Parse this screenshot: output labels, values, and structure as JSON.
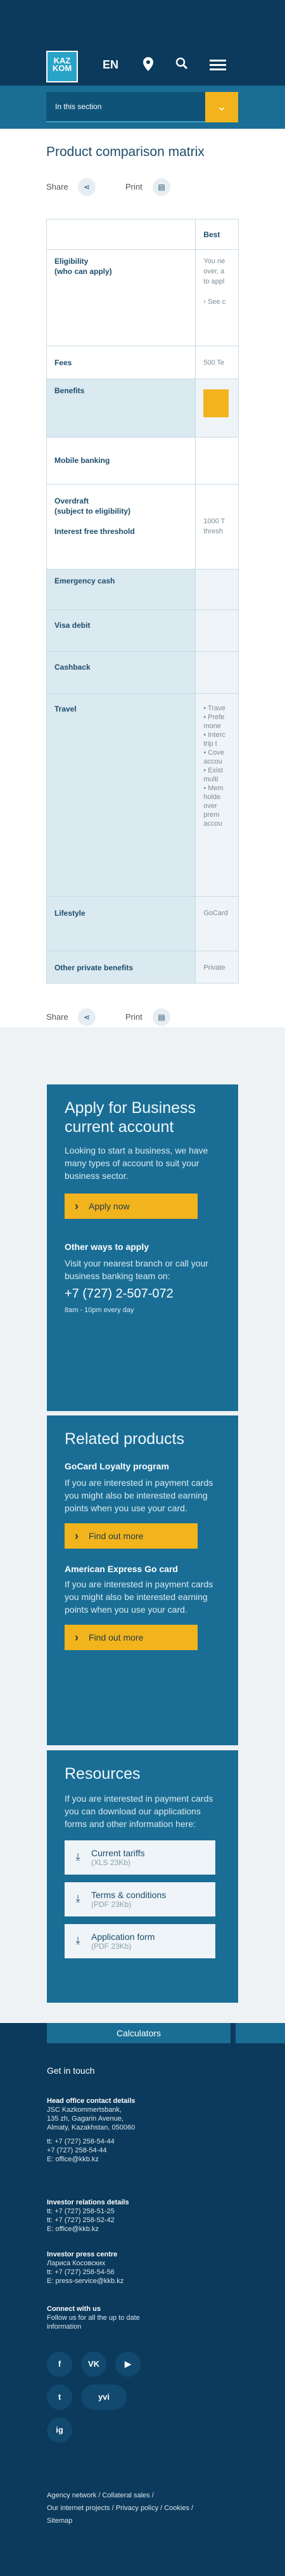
{
  "header": {
    "logo": [
      "KAZ",
      "KOM"
    ],
    "language": "EN",
    "icons": [
      "location-pin-icon",
      "search-icon",
      "menu-icon"
    ]
  },
  "section_nav": {
    "label": "In this section"
  },
  "page": {
    "title": "Product comparison matrix"
  },
  "share": {
    "share_label": "Share",
    "print_label": "Print"
  },
  "matrix": {
    "column_header": "Best",
    "rows": [
      {
        "label": "Eligibility\n(who can apply)",
        "value": "You ne\nover, a\nto appl\n\n› See c"
      },
      {
        "label": "Fees",
        "value": "500 Te"
      },
      {
        "label": "Benefits",
        "value": ""
      },
      {
        "label": "Mobile banking",
        "value": ""
      },
      {
        "label": "Overdraft\n(subject to eligibility)\n\nInterest free threshold",
        "value": "\n\n1000 T\nthresh"
      },
      {
        "label": "Emergency cash",
        "value": ""
      },
      {
        "label": "Visa debit",
        "value": ""
      },
      {
        "label": "Cashback",
        "value": ""
      },
      {
        "label": "Travel",
        "value": "• Trave\n• Prefe\n  mone\n• Interc\n  trip t\n• Cove\n  accou\n• Exist\n  multi\n• Mem\n  holde\n  over\n  prem\n  accou"
      },
      {
        "label": "Lifestyle",
        "value": "GoCard"
      },
      {
        "label": "Other private benefits",
        "value": "Private"
      }
    ]
  },
  "apply": {
    "title": "Apply for Business current account",
    "text": "Looking to start a business, we have many types of account to suit your business sector.",
    "button": "Apply now",
    "other_title": "Other ways to apply",
    "other_text": "Visit your nearest branch or call your business banking team on:",
    "phone": "+7 (727) 2-507-072",
    "hours": "8am - 10pm every day"
  },
  "related": {
    "title": "Related products",
    "items": [
      {
        "title": "GoCard Loyalty program",
        "text": "If you are interested in payment cards you might also be interested earning points when you use your card.",
        "button": "Find out more"
      },
      {
        "title": "American Express Go card",
        "text": "If you are interested in payment cards you might also be interested earning points when you use your card.",
        "button": "Find out more"
      }
    ]
  },
  "resources": {
    "title": "Resources",
    "text": "If you are interested in payment cards you can download our applications forms and other information here:",
    "docs": [
      {
        "name": "Current tariffs",
        "size": "(XLS 23Kb)"
      },
      {
        "name": "Terms & conditions",
        "size": "(PDF 23Kb)"
      },
      {
        "name": "Application form",
        "size": "(PDF 23Kb)"
      }
    ]
  },
  "footer": {
    "calculators": "Calculators",
    "get_in_touch": "Get in touch",
    "head_office_title": "Head office contact details",
    "head_office": [
      "JSC Kazkommertsbank,",
      "135 zh, Gagarin Avenue,",
      "Almaty, Kazakhstan, 050060",
      "",
      "tt: +7 (727) 258-54-44",
      "     +7 (727) 258-54-44",
      "E: office@kkb.kz"
    ],
    "investor_title": "Investor relations details",
    "investor": [
      "tt: +7 (727) 258-51-25",
      "tt: +7 (727) 258-52-42",
      "E: office@kkb.kz"
    ],
    "press_title": "Investor press centre",
    "press": [
      "Лариса Косовских",
      "tt: +7 (727) 258-54-56",
      "E: press-service@kkb.kz"
    ],
    "connect_title": "Connect with us",
    "connect_text": "Follow us for all the up to date information",
    "social": [
      "f",
      "VK",
      "▶",
      "t",
      "yvi",
      "ig"
    ],
    "links_1": "Agency network   /   Collateral sales   /",
    "links_2": "Our internet projects   /   Privacy policy   /   Cookies   /",
    "links_3": "Sitemap"
  }
}
